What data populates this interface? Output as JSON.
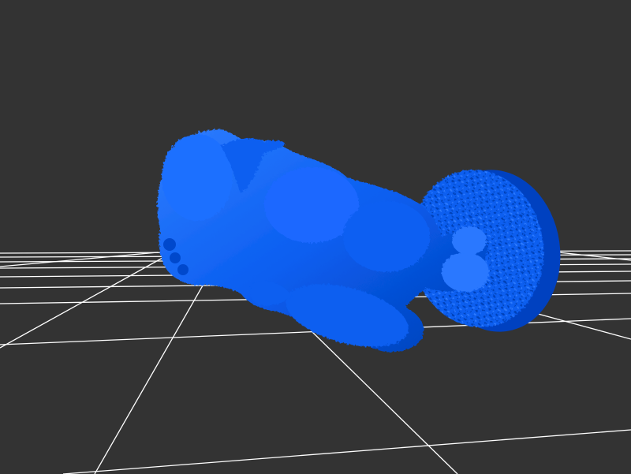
{
  "viewport": {
    "background_color": "#333333",
    "grid_color": "#ffffff",
    "model_color": "#0a5ef0",
    "model_icon": "3d-model-mesh"
  },
  "grid": {
    "visible": true,
    "style": "perspective ground plane"
  },
  "model": {
    "visible": true,
    "description_icon": "creature-figure-on-round-base"
  }
}
